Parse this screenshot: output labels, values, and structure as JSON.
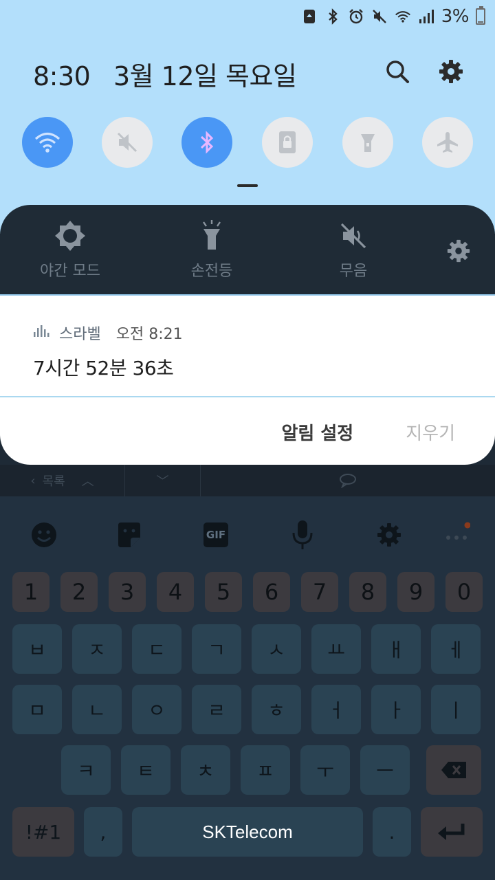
{
  "status": {
    "battery_text": "3%"
  },
  "header": {
    "time": "8:30",
    "date": "3월 12일 목요일"
  },
  "quick_toggles": [
    {
      "name": "wifi",
      "on": true
    },
    {
      "name": "mute",
      "on": false
    },
    {
      "name": "bluetooth",
      "on": true
    },
    {
      "name": "screen-lock-rotation",
      "on": false
    },
    {
      "name": "flashlight",
      "on": false
    },
    {
      "name": "airplane",
      "on": false
    }
  ],
  "quick_actions": {
    "night_mode": "야간 모드",
    "flashlight": "손전등",
    "mute": "무음"
  },
  "notification": {
    "app_name": "스라벨",
    "time": "오전 8:21",
    "body": "7시간 52분 36초",
    "actions": {
      "settings": "알림 설정",
      "clear": "지우기"
    }
  },
  "background_app": {
    "list_label": "목록"
  },
  "keyboard": {
    "numbers": [
      "1",
      "2",
      "3",
      "4",
      "5",
      "6",
      "7",
      "8",
      "9",
      "0"
    ],
    "row1": [
      "ㅂ",
      "ㅈ",
      "ㄷ",
      "ㄱ",
      "ㅅ",
      "ㅛ",
      "ㅐ",
      "ㅔ"
    ],
    "row2": [
      "ㅁ",
      "ㄴ",
      "ㅇ",
      "ㄹ",
      "ㅎ",
      "ㅓ",
      "ㅏ",
      "ㅣ"
    ],
    "row3": [
      "ㅋ",
      "ㅌ",
      "ㅊ",
      "ㅍ",
      "ㅜ",
      "ㅡ"
    ],
    "symbols_key": "!#1",
    "comma_key": ",",
    "period_key": ".",
    "space_label": "SKTelecom",
    "toolbar_gif": "GIF"
  },
  "colors": {
    "accent_blue": "#4a97f5",
    "panel_bg": "#b3dffb",
    "keyboard_bg": "#223140"
  }
}
